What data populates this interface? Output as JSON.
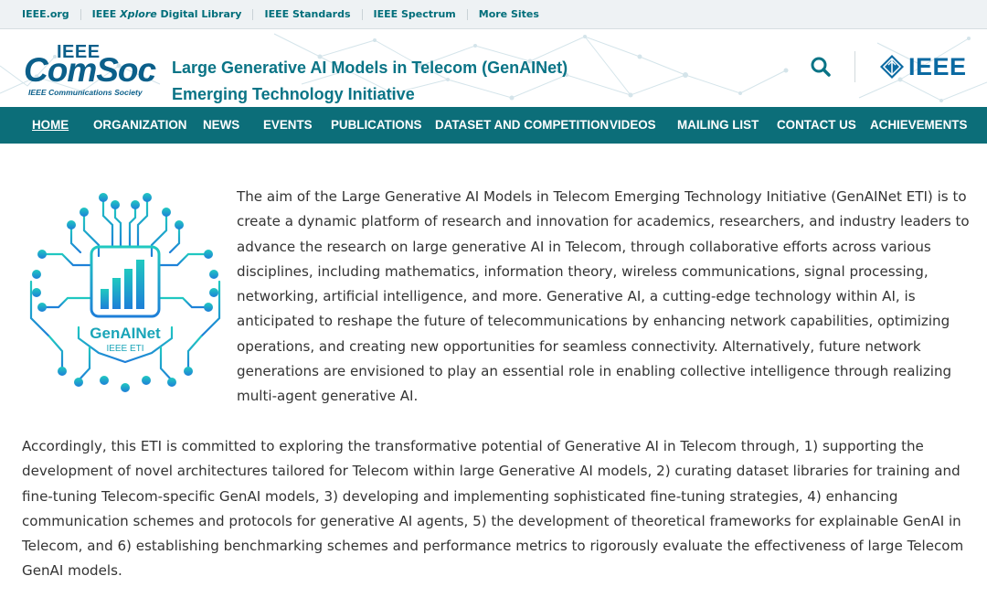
{
  "topbar": {
    "links": [
      {
        "label": "IEEE.org"
      },
      {
        "label_pre": "IEEE ",
        "label_italic": "Xplore",
        "label_post": " Digital Library"
      },
      {
        "label": "IEEE Standards"
      },
      {
        "label": "IEEE Spectrum"
      },
      {
        "label": "More Sites"
      }
    ]
  },
  "header": {
    "logo": {
      "ieee": "IEEE",
      "comsoc": "ComSoc",
      "society": "IEEE Communications Society"
    },
    "title_line1": "Large Generative AI Models in Telecom (GenAINet)",
    "title_line2": "Emerging Technology Initiative",
    "search_icon": "search-icon",
    "ieee_logo_text": "IEEE"
  },
  "nav": {
    "items": [
      {
        "label": "HOME",
        "active": true
      },
      {
        "label": "ORGANIZATION"
      },
      {
        "label": "NEWS"
      },
      {
        "label": "EVENTS"
      },
      {
        "label": "PUBLICATIONS"
      },
      {
        "label": "DATASET AND COMPETITION"
      },
      {
        "label": "VIDEOS"
      },
      {
        "label": "MAILING LIST"
      },
      {
        "label": "CONTACT US"
      },
      {
        "label": "ACHIEVEMENTS"
      }
    ]
  },
  "content": {
    "logo": {
      "name": "GenAINet",
      "sub": "IEEE ETI"
    },
    "paragraph1": "The aim of the Large Generative AI Models in Telecom Emerging Technology Initiative (GenAINet ETI) is to create a dynamic platform of research and innovation for academics, researchers, and industry leaders to advance the research on large generative AI in Telecom, through collaborative efforts across various disciplines, including mathematics, information theory, wireless communications, signal processing, networking, artificial intelligence, and more. Generative AI, a cutting-edge technology within AI, is anticipated to reshape the future of telecommunications by enhancing network capabilities, optimizing operations, and creating new opportunities for seamless connectivity. Alternatively, future network generations are envisioned to play an essential role in enabling collective intelligence through realizing multi-agent generative AI.",
    "paragraph2": "Accordingly, this ETI is committed to exploring the transformative potential of Generative AI in Telecom through, 1) supporting the development of novel architectures tailored for Telecom within large Generative AI models, 2) curating dataset libraries for training and fine-tuning Telecom-specific GenAI models, 3) developing and implementing sophisticated fine-tuning strategies, 4) enhancing communication schemes and protocols for generative AI agents, 5) the development of theoretical frameworks for explainable GenAI in Telecom, and 6) establishing benchmarking schemes and performance metrics to rigorously evaluate the effectiveness of large Telecom GenAI models."
  },
  "colors": {
    "teal": "#0c6e79",
    "link": "#006e7a",
    "brand_blue": "#0b5f8a",
    "title_teal": "#0a7486",
    "logo_cyan": "#1cc2c4",
    "logo_blue": "#1e88d8"
  }
}
